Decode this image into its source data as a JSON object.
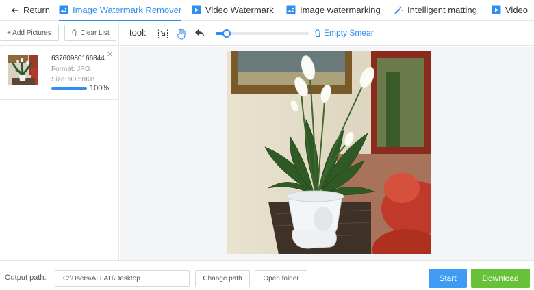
{
  "nav": {
    "back_label": "Return",
    "tabs": [
      {
        "label": "Image Watermark Remover",
        "active": true
      },
      {
        "label": "Video Watermark",
        "active": false
      },
      {
        "label": "Image watermarking",
        "active": false
      },
      {
        "label": "Intelligent matting",
        "active": false
      },
      {
        "label": "Video",
        "active": false
      }
    ]
  },
  "sidebar": {
    "add_label": "+ Add Pictures",
    "clear_label": "Clear List",
    "files": [
      {
        "name": "63760980166844...",
        "format": "Format:  JPG",
        "size": "Size:  90.58KB",
        "progress": 1.0,
        "progress_text": "100%"
      }
    ]
  },
  "toolbar": {
    "label": "tool:",
    "slider_value": 0.12,
    "empty_smear_label": "Empty Smear",
    "icons": [
      "selection-tool-icon",
      "hand-tool-icon",
      "undo-icon",
      "trash-icon"
    ]
  },
  "footer": {
    "output_label": "Output path:",
    "output_path": "C:\\Users\\ALLAH\\Desktop",
    "change_path_label": "Change path",
    "open_folder_label": "Open folder",
    "start_label": "Start",
    "download_label": "Download"
  },
  "colors": {
    "accent": "#2f8ff0",
    "start": "#3f9cf3",
    "download": "#67c23a"
  }
}
